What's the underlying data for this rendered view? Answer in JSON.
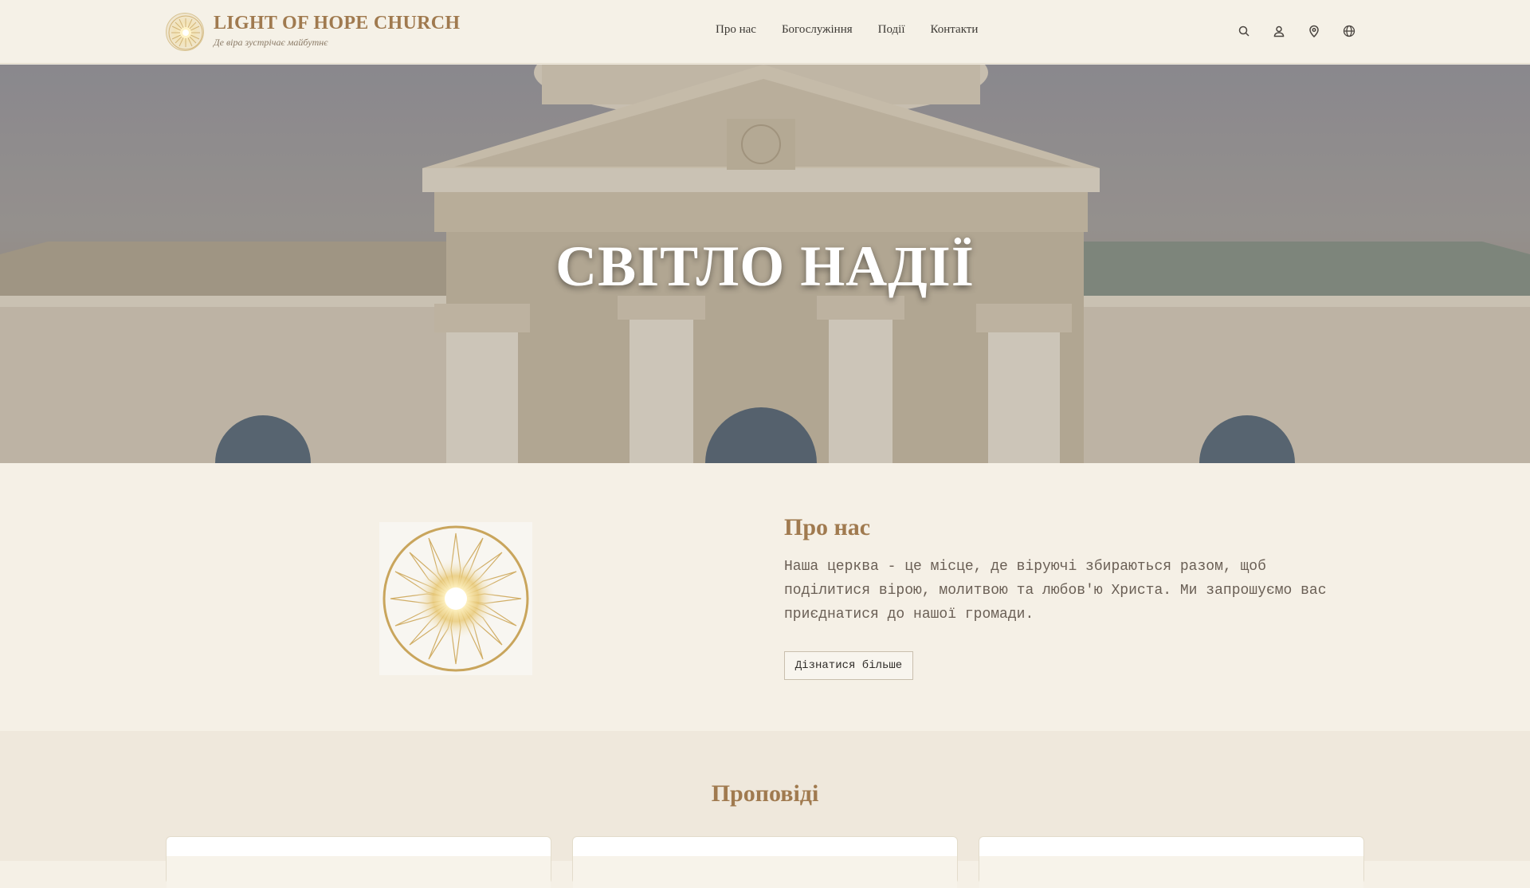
{
  "header": {
    "brand_title": "LIGHT OF HOPE CHURCH",
    "brand_tagline": "Де віра зустрічає майбутнє",
    "nav": [
      "Про нас",
      "Богослужіння",
      "Події",
      "Контакти"
    ],
    "icons": [
      "search-icon",
      "user-icon",
      "location-pin-icon",
      "globe-icon"
    ]
  },
  "hero": {
    "title": "СВІТЛО НАДІЇ"
  },
  "about": {
    "heading": "Про нас",
    "text": "Наша церква - це місце, де віруючі збираються разом, щоб поділитися вірою, молитвою та любов'ю Христа. Ми запрошуємо вас приєднатися до нашої громади.",
    "button": "Дізнатися більше"
  },
  "sermons": {
    "heading": "Проповіді",
    "card_count": 3
  },
  "colors": {
    "accent": "#a07a4f",
    "background": "#f5f0e6",
    "section_alt": "#efe8dc"
  }
}
